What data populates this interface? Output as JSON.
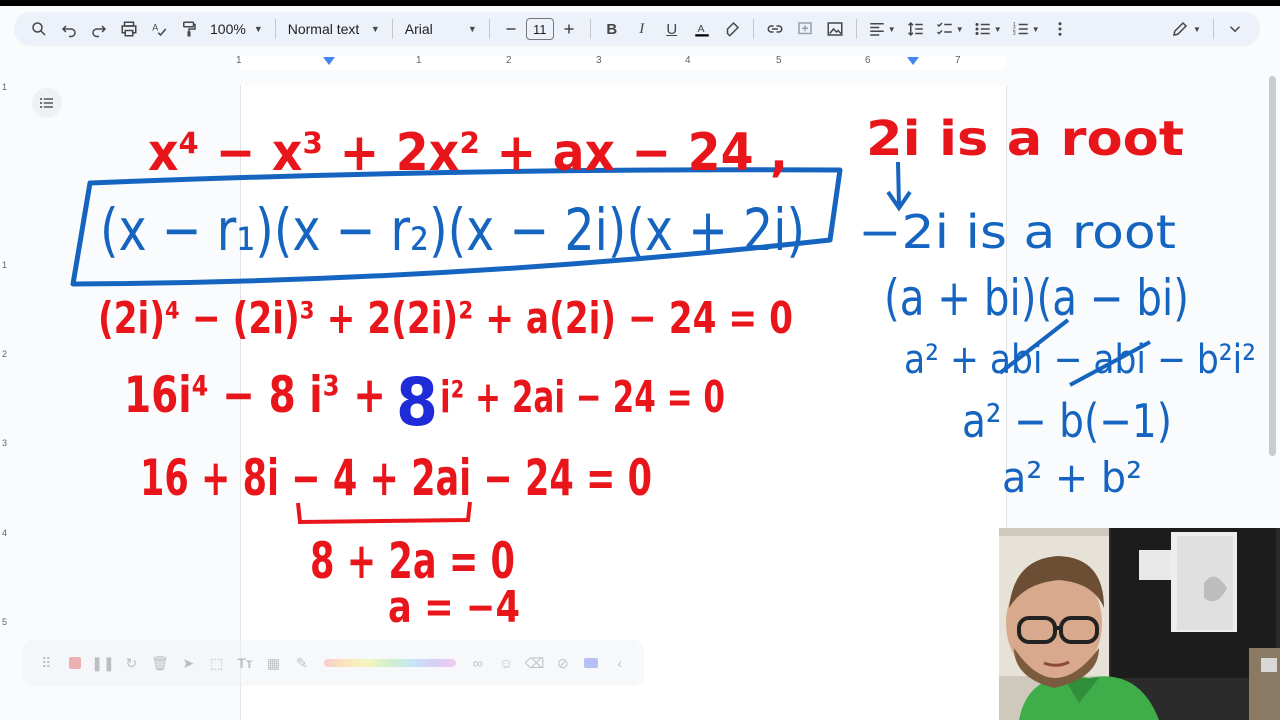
{
  "toolbar": {
    "zoom": "100%",
    "style": "Normal text",
    "font": "Arial",
    "font_size": "11"
  },
  "ruler": {
    "top_numbers": [
      "1",
      "1",
      "2",
      "3",
      "4",
      "5",
      "6",
      "7"
    ],
    "left_numbers": [
      "1",
      "1",
      "2",
      "3",
      "4",
      "5"
    ]
  },
  "handwriting": {
    "line1_red": "x⁴ − x³ + 2x² + ax − 24 ,",
    "line2_blue": "(x − r₁)(x − r₂)(x − 2i)(x + 2i)",
    "line3_red": "(2i)⁴ − (2i)³ + 2(2i)² + a(2i) − 24 = 0",
    "line4_red_a": "16i⁴ − 8 i³ +",
    "line4_blue": "8",
    "line4_red_b": "i² + 2ai − 24 = 0",
    "line5_red": "16 + 8i − 4 + 2ai − 24 = 0",
    "line6_red": "8 + 2a = 0",
    "line7_red": "a = −4",
    "right1_red": "2i is a root",
    "right2_blue": "−2i is a root",
    "right3_blue": "(a + bi)(a − bi)",
    "right4_blue": "a² + abi − abi − b²i²",
    "right5_blue": "a² − b(−1)",
    "right6_blue": "a² + b²"
  },
  "colors": {
    "red_ink": "#e8161b",
    "blue_ink": "#1565c0"
  }
}
